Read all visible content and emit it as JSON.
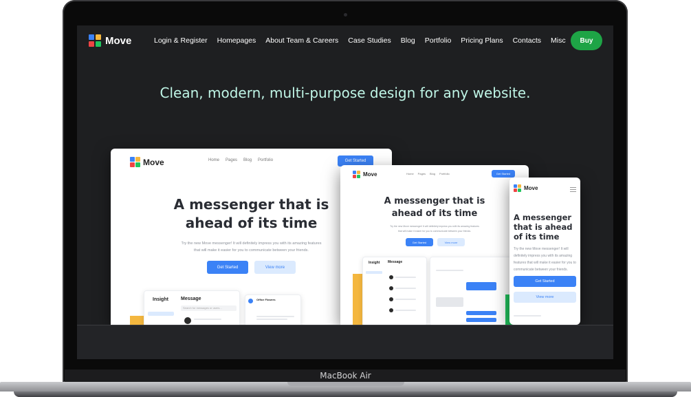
{
  "device": {
    "label": "MacBook Air"
  },
  "colors": {
    "accent_green": "#1ea446",
    "headline": "#bff5e6",
    "screen_bg": "#1e1f21",
    "mock_blue": "#3b82f6",
    "mock_yellow": "#f4b73f"
  },
  "logo": {
    "text": "Move",
    "tiles": [
      "#3b82f6",
      "#f4b73f",
      "#ef4444",
      "#22c55e"
    ]
  },
  "nav": {
    "items": [
      "Login & Register",
      "Homepages",
      "About Team & Careers",
      "Case Studies",
      "Blog",
      "Portfolio",
      "Pricing Plans",
      "Contacts",
      "Misc"
    ],
    "buy_label": "Buy"
  },
  "headline": "Clean, modern, multi-purpose design for any website.",
  "mockups": {
    "desktop": {
      "logo": "Move",
      "nav": [
        "Home",
        "Pages",
        "Blog",
        "Portfolio"
      ],
      "cta": "Get Started",
      "title_line1": "A messenger that is",
      "title_line2": "ahead of its time",
      "subtitle_line1": "Try the new Move messenger! It will definitely impress you with its amazing features",
      "subtitle_line2": "that will make it easier for you to communicate between your friends.",
      "primary": "Get Started",
      "secondary": "View more",
      "panel_insight": "Insight",
      "panel_message": "Message",
      "panel_search": "Search for messages or users...",
      "chat_name": "Office Flowers"
    },
    "tablet": {
      "logo": "Move",
      "nav": [
        "Home",
        "Pages",
        "Blog",
        "Portfolio"
      ],
      "cta": "Get Started",
      "title_line1": "A messenger that is",
      "title_line2": "ahead of its time",
      "subtitle_line1": "Try the new Move messenger! It will definitely impress you with its amazing features",
      "subtitle_line2": "that will make it easier for you to communicate between your friends.",
      "primary": "Get Started",
      "secondary": "View more",
      "panel_insight": "Insight",
      "panel_message": "Message"
    },
    "mobile": {
      "logo": "Move",
      "title_line1": "A messenger",
      "title_line2": "that is ahead",
      "title_line3": "of its time",
      "subtitle": "Try the new Move messenger! It will definitely impress you with its amazing features that will make it easier for you to communicate between your friends.",
      "primary": "Get Started",
      "secondary": "View more"
    }
  }
}
